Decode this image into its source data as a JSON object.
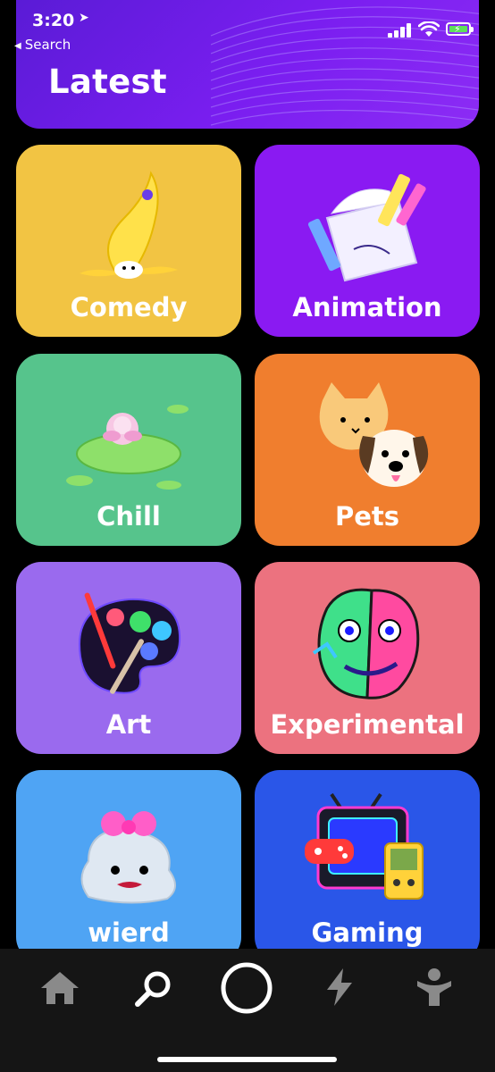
{
  "status_bar": {
    "time": "3:20",
    "location_glyph": "➤",
    "back_label": "Search",
    "back_glyph": "◀"
  },
  "header": {
    "title": "Latest"
  },
  "categories": [
    {
      "label": "Comedy",
      "color": "#F2C443"
    },
    {
      "label": "Animation",
      "color": "#8A1AF2"
    },
    {
      "label": "Chill",
      "color": "#56C48C"
    },
    {
      "label": "Pets",
      "color": "#F07E2E"
    },
    {
      "label": "Art",
      "color": "#9A6AEE"
    },
    {
      "label": "Experimental",
      "color": "#EC727F"
    },
    {
      "label": "wierd",
      "color": "#4FA4F4"
    },
    {
      "label": "Gaming",
      "color": "#2A56E8"
    }
  ],
  "tab_bar": {
    "items": [
      "home-icon",
      "search-icon",
      "record-icon",
      "lightning-icon",
      "profile-icon"
    ]
  }
}
